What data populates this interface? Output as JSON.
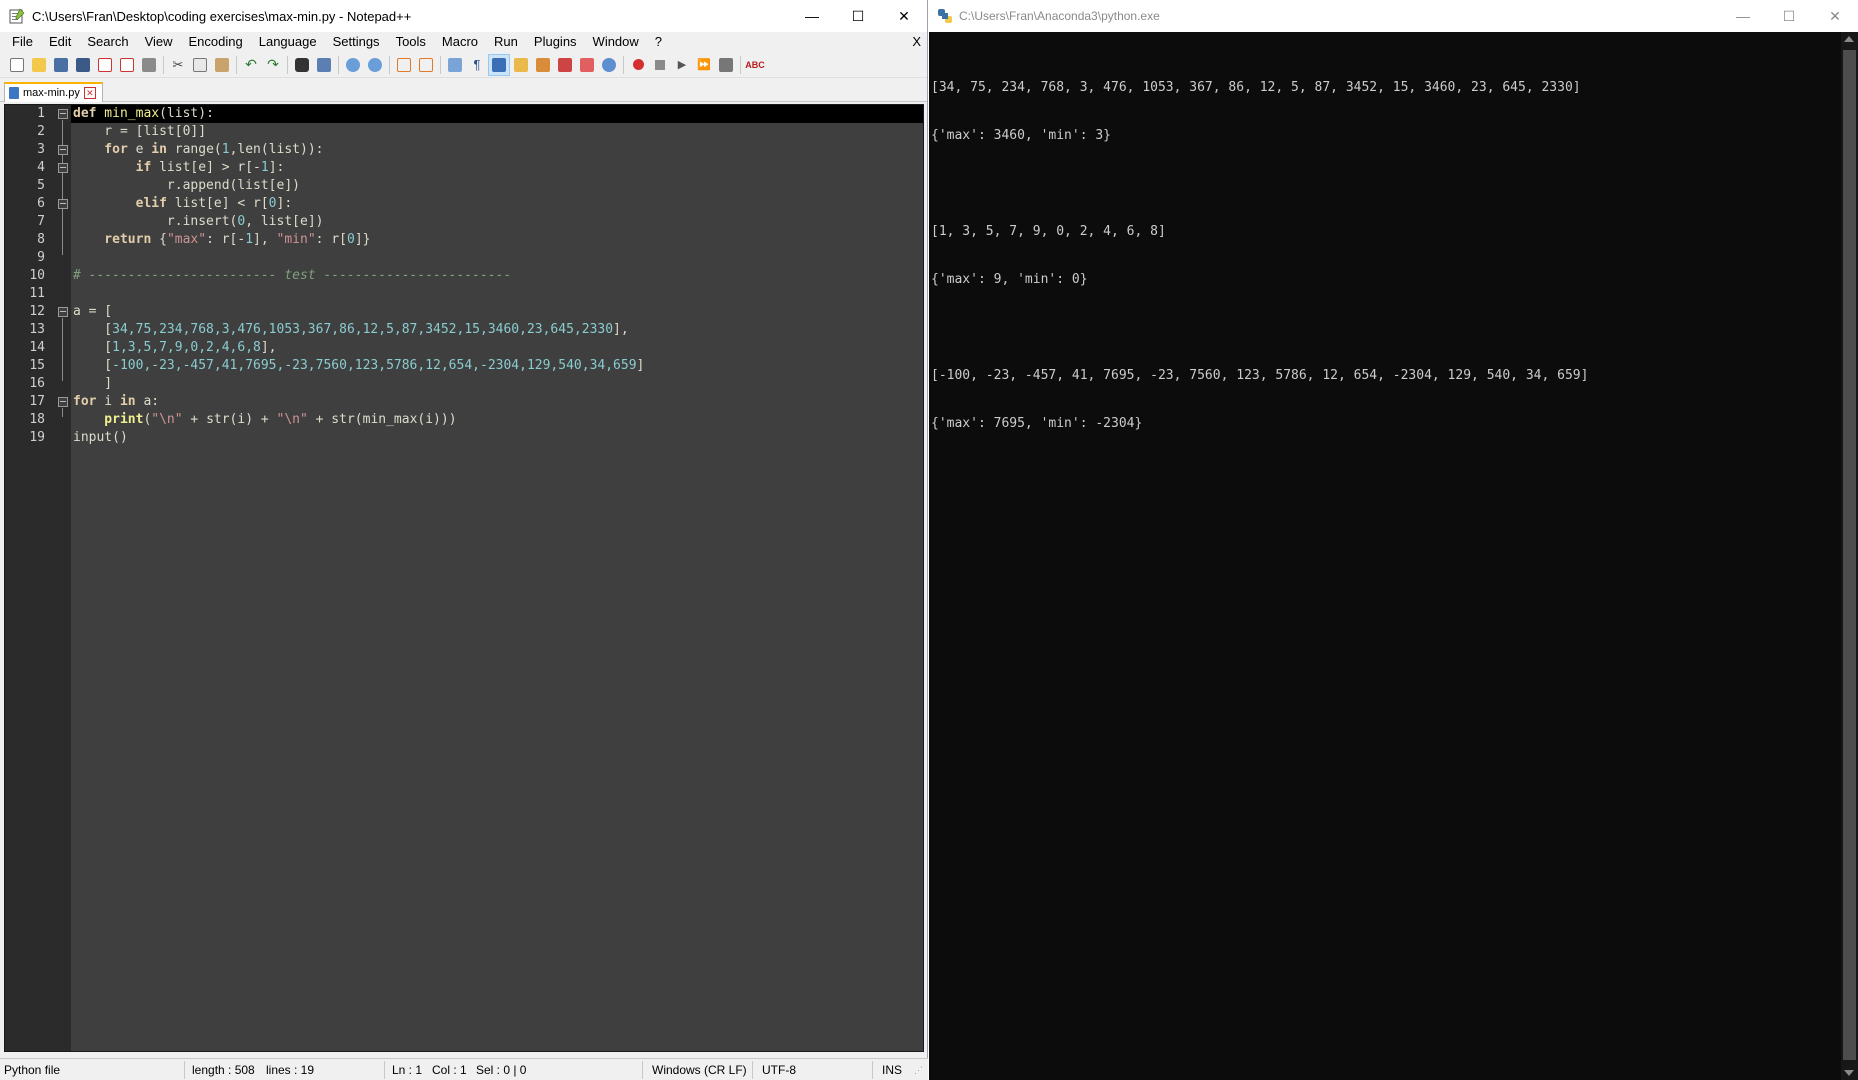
{
  "notepad": {
    "title": "C:\\Users\\Fran\\Desktop\\coding exercises\\max-min.py - Notepad++",
    "window_buttons": {
      "minimize": "—",
      "maximize": "☐",
      "close": "✕"
    },
    "menu": [
      "File",
      "Edit",
      "Search",
      "View",
      "Encoding",
      "Language",
      "Settings",
      "Tools",
      "Macro",
      "Run",
      "Plugins",
      "Window",
      "?"
    ],
    "menu_close": "X",
    "tab": {
      "label": "max-min.py"
    },
    "line_numbers": [
      "1",
      "2",
      "3",
      "4",
      "5",
      "6",
      "7",
      "8",
      "9",
      "10",
      "11",
      "12",
      "13",
      "14",
      "15",
      "16",
      "17",
      "18",
      "19"
    ],
    "code": {
      "l1": {
        "kw": "def",
        "name": " min_max",
        "rest": "(list):"
      },
      "l2": {
        "text": "    r = [list[0]]"
      },
      "l3": {
        "kw": "    for",
        "a": " e ",
        "kw2": "in",
        "b": " range(",
        "n1": "1",
        "c": ",len(list)):"
      },
      "l4": {
        "kw": "        if",
        "a": " list[e] > r[-",
        "n1": "1",
        "b": "]:"
      },
      "l5": {
        "text": "            r.append(list[e])"
      },
      "l6": {
        "kw": "        elif",
        "a": " list[e] < r[",
        "n0": "0",
        "b": "]:"
      },
      "l7": {
        "a": "            r.insert(",
        "n0": "0",
        "b": ", list[e])"
      },
      "l8": {
        "kw": "    return",
        "a": " {",
        "s1": "\"max\"",
        "b": ": r[-",
        "n1": "1",
        "c": "], ",
        "s2": "\"min\"",
        "d": ": r[",
        "n0": "0",
        "e": "]}"
      },
      "l10": {
        "text": "# ------------------------ test ------------------------"
      },
      "l12": {
        "text": "a = ["
      },
      "l13": {
        "a": "    [",
        "nums": "34,75,234,768,3,476,1053,367,86,12,5,87,3452,15,3460,23,645,2330",
        "b": "],"
      },
      "l14": {
        "a": "    [",
        "nums": "1,3,5,7,9,0,2,4,6,8",
        "b": "],"
      },
      "l15": {
        "a": "    [",
        "nums": "-100,-23,-457,41,7695,-23,7560,123,5786,12,654,-2304,129,540,34,659",
        "b": "]"
      },
      "l16": {
        "text": "    ]"
      },
      "l17": {
        "kw": "for",
        "a": " i ",
        "kw2": "in",
        "b": " a:"
      },
      "l18": {
        "bi": "    print",
        "a": "(",
        "s1": "\"\\n\"",
        "b": " + str(i) + ",
        "s2": "\"\\n\"",
        "c": " + str(min_max(i)))"
      },
      "l19": {
        "text": "input()"
      }
    },
    "status": {
      "type": "Python file",
      "length": "length : 508",
      "lines": "lines : 19",
      "ln": "Ln : 1",
      "col": "Col : 1",
      "sel": "Sel : 0 | 0",
      "eol": "Windows (CR LF)",
      "encoding": "UTF-8",
      "mode": "INS"
    }
  },
  "console": {
    "title": "C:\\Users\\Fran\\Anaconda3\\python.exe",
    "window_buttons": {
      "minimize": "—",
      "maximize": "☐",
      "close": "✕"
    },
    "output": [
      "[34, 75, 234, 768, 3, 476, 1053, 367, 86, 12, 5, 87, 3452, 15, 3460, 23, 645, 2330]",
      "{'max': 3460, 'min': 3}",
      "",
      "[1, 3, 5, 7, 9, 0, 2, 4, 6, 8]",
      "{'max': 9, 'min': 0}",
      "",
      "[-100, -23, -457, 41, 7695, -23, 7560, 123, 5786, 12, 654, -2304, 129, 540, 34, 659]",
      "{'max': 7695, 'min': -2304}"
    ]
  },
  "colors": {
    "editor_bg": "#3f3f3f",
    "gutter_bg": "#2b2b2b",
    "keyword": "#e3ceab",
    "number": "#8acccf",
    "string": "#cc9393",
    "comment": "#7f9f7f",
    "console_bg": "#0c0c0c",
    "console_text": "#cccccc"
  }
}
